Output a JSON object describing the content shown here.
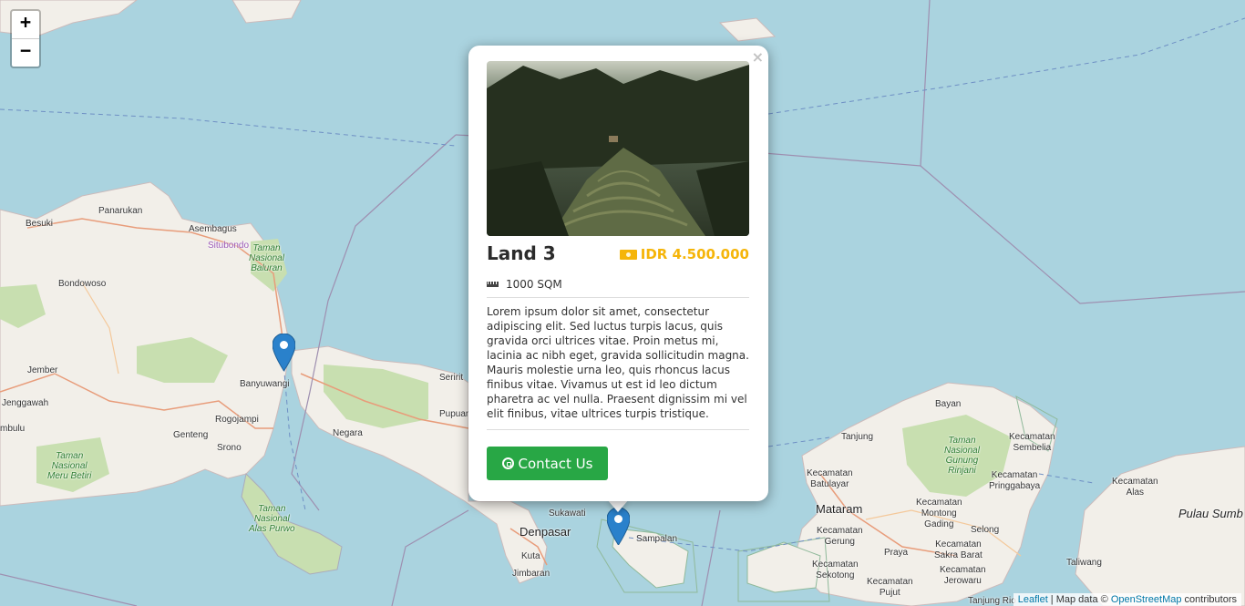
{
  "map": {
    "zoom_in_label": "+",
    "zoom_out_label": "−",
    "places": [
      {
        "label": "Besuki"
      },
      {
        "label": "Panarukan"
      },
      {
        "label": "Asembagus"
      },
      {
        "label": "Situbondo"
      },
      {
        "label": "Bondowoso"
      },
      {
        "label": "Jember"
      },
      {
        "label": "Jenggawah"
      },
      {
        "label": "mbulu"
      },
      {
        "label": "Banyuwangi"
      },
      {
        "label": "Rogojampi"
      },
      {
        "label": "Genteng"
      },
      {
        "label": "Srono"
      },
      {
        "label": "Negara"
      },
      {
        "label": "Seririt"
      },
      {
        "label": "Pupuan"
      },
      {
        "label": "Sukawati"
      },
      {
        "label": "Denpasar"
      },
      {
        "label": "Kuta"
      },
      {
        "label": "Jimbaran"
      },
      {
        "label": "Sampalan"
      },
      {
        "label": "Tanjung"
      },
      {
        "label": "Bayan"
      },
      {
        "label": "Kecamatan\nBatulayar"
      },
      {
        "label": "Mataram"
      },
      {
        "label": "Kecamatan\nMontong\nGading"
      },
      {
        "label": "Selong"
      },
      {
        "label": "Kecamatan\nGerung"
      },
      {
        "label": "Praya"
      },
      {
        "label": "Kecamatan\nSakra Barat"
      },
      {
        "label": "Kecamatan\nSekotong"
      },
      {
        "label": "Kecamatan\nPujut"
      },
      {
        "label": "Kecamatan\nJerowaru"
      },
      {
        "label": "Kecamatan\nSembelia"
      },
      {
        "label": "Kecamatan\nPringgabaya"
      },
      {
        "label": "Kecamatan\nAlas"
      },
      {
        "label": "Taliwang"
      },
      {
        "label": "Tanjung Rio"
      }
    ],
    "parks": [
      {
        "label": "Taman\nNasional\nBaluran"
      },
      {
        "label": "Taman\nNasional\nMeru Betiri"
      },
      {
        "label": "Taman\nNasional\nAlas Purwo"
      },
      {
        "label": "Taman\nNasional\nGunung\nRinjani"
      }
    ],
    "region_label": "Pulau Sumb",
    "attribution": {
      "leaflet": "Leaflet",
      "sep": " | Map data © ",
      "osm": "OpenStreetMap",
      "contributors": " contributors"
    }
  },
  "popup": {
    "close_label": "×",
    "title": "Land 3",
    "price": "IDR 4.500.000",
    "area": "1000 SQM",
    "description": "Lorem ipsum dolor sit amet, consectetur adipiscing elit. Sed luctus turpis lacus, quis gravida orci ultrices vitae. Proin metus mi, lacinia ac nibh eget, gravida sollicitudin magna. Mauris molestie urna leo, quis rhoncus lacus finibus vitae. Vivamus ut est id leo dictum pharetra ac vel nulla. Praesent dignissim mi vel elit finibus, vitae ultrices turpis tristique.",
    "contact_label": "Contact Us"
  },
  "colors": {
    "sea": "#aad3df",
    "land": "#f2efe9",
    "park": "#c8dfb0",
    "price": "#f5b50a",
    "button": "#28a745",
    "marker": "#2a81cb"
  }
}
